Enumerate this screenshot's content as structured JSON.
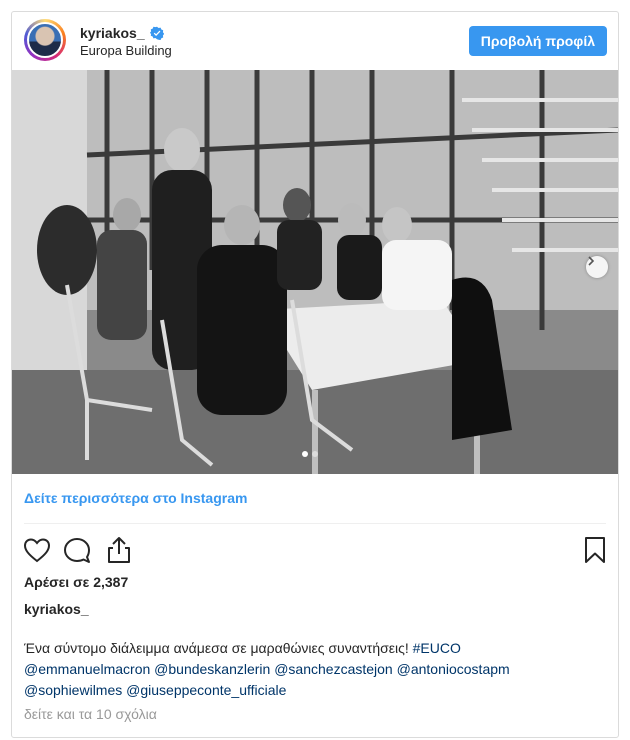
{
  "header": {
    "username": "kyriakos_",
    "location": "Europa Building",
    "verified_icon": "verified-badge-icon",
    "view_profile_label": "Προβολή προφίλ"
  },
  "photo": {
    "carousel_dots": 2,
    "active_dot": 1,
    "next_icon": "chevron-right-icon"
  },
  "see_more_label": "Δείτε περισσότερα στο Instagram",
  "actions": {
    "like_icon": "heart-icon",
    "comment_icon": "comment-bubble-icon",
    "share_icon": "share-upload-icon",
    "save_icon": "bookmark-icon"
  },
  "likes_text": "Αρέσει σε 2,387",
  "owner": "kyriakos_",
  "caption": {
    "text": "Ένα σύντομο διάλειμμα ανάμεσα σε μαραθώνιες συναντήσεις! ",
    "hashtag": "#EUCO",
    "mentions_line1": [
      "@emmanuelmacron",
      "@bundeskanzlerin",
      "@sanchezcastejon",
      "@antoniocostapm"
    ],
    "mentions_line2": [
      "@sophiewilmes",
      "@giuseppeconte_ufficiale"
    ]
  },
  "comments_link": "δείτε και τα 10 σχόλια",
  "colors": {
    "accent_blue": "#3897f0",
    "link_dark": "#003569",
    "text": "#262626",
    "muted": "#999999"
  }
}
